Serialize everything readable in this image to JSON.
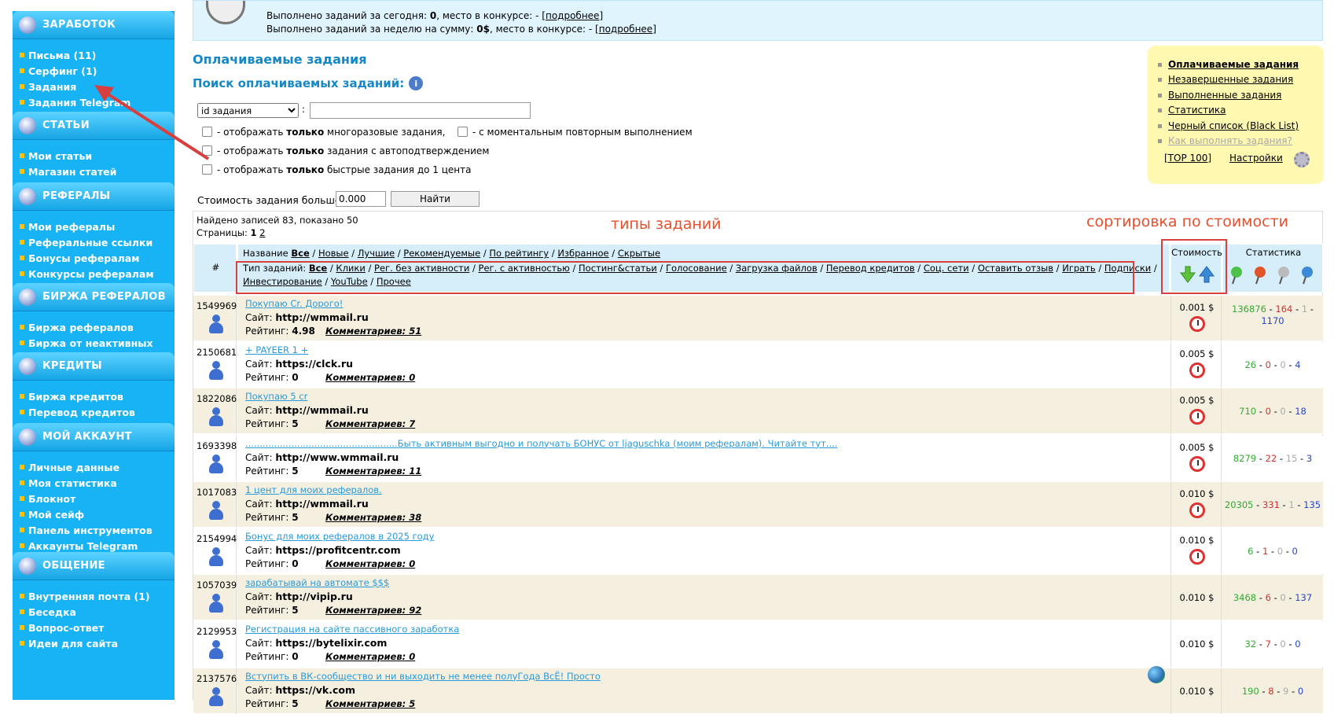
{
  "sidebar": {
    "sections": [
      {
        "title": "ЗАРАБОТОК",
        "icon": "money-bag-icon",
        "items": [
          "Письма (11)",
          "Серфинг (1)",
          "Задания",
          "Задания Telegram"
        ]
      },
      {
        "title": "СТАТЬИ",
        "icon": "articles-icon",
        "items": [
          "Мои статьи",
          "Магазин статей"
        ]
      },
      {
        "title": "РЕФЕРАЛЫ",
        "icon": "referrals-icon",
        "items": [
          "Мои рефералы",
          "Реферальные ссылки",
          "Бонусы рефералам",
          "Конкурсы рефералам"
        ]
      },
      {
        "title": "БИРЖА РЕФЕРАЛОВ",
        "icon": "exchange-icon",
        "items": [
          "Биржа рефералов",
          "Биржа от неактивных"
        ]
      },
      {
        "title": "КРЕДИТЫ",
        "icon": "credits-icon",
        "items": [
          "Биржа кредитов",
          "Перевод кредитов"
        ]
      },
      {
        "title": "МОЙ АККАУНТ",
        "icon": "account-icon",
        "items": [
          "Личные данные",
          "Моя статистика",
          "Блокнот",
          "Мой сейф",
          "Панель инструментов",
          "Аккаунты Telegram"
        ]
      },
      {
        "title": "ОБЩЕНИЕ",
        "icon": "chat-icon",
        "items": [
          "Внутренняя почта (1)",
          "Беседка",
          "Вопрос-ответ",
          "Идеи для сайта"
        ]
      }
    ]
  },
  "topbox": {
    "line1_prefix": "Выполнено заданий за сегодня: ",
    "line1_value": "0",
    "line1_mid": ", место в конкурсе: - [",
    "line1_link": "подробнее",
    "line1_end": "]",
    "line2_prefix": "Выполнено заданий за неделю на сумму: ",
    "line2_value": "0$",
    "line2_mid": ", место в конкурсе: - [",
    "line2_link": "подробнее",
    "line2_end": "]"
  },
  "page_title": "Оплачиваемые задания",
  "search_title": "Поиск оплачиваемых заданий:",
  "search": {
    "select_value": "id задания",
    "filters": [
      {
        "pre": " - отображать ",
        "bold": "только",
        "post": " многоразовые задания,"
      },
      {
        "pre": " - с моментальным повторным выполнением",
        "bold": "",
        "post": ""
      },
      {
        "pre": " - отображать ",
        "bold": "только",
        "post": " задания с автоподтверждением"
      },
      {
        "pre": " - отображать ",
        "bold": "только",
        "post": " быстрые задания до 1 цента"
      }
    ],
    "cost_label": "Стоимость задания больше",
    "cost_value": "0.000",
    "find_button": "Найти"
  },
  "right_menu": {
    "items": [
      "Оплачиваемые задания",
      "Незавершенные задания",
      "Выполненные задания",
      "Статистика",
      "Черный список (Black List)",
      "Как выполнять задания?"
    ],
    "top100": "[TOP 100]",
    "settings": "Настройки"
  },
  "results": {
    "found": "Найдено записей 83, показано 50",
    "pages_label": "Страницы: ",
    "page1": "1",
    "page2": "2"
  },
  "annotations": {
    "types": "типы заданий",
    "sort": "сортировка по стоимости"
  },
  "table_header": {
    "num": "#",
    "name_label": "Название ",
    "name_links": [
      "Все",
      "Новые",
      "Лучшие",
      "Рекомендуемые",
      "По рейтингу",
      "Избранное",
      "Скрытые"
    ],
    "type_label": "Тип заданий: ",
    "type_links": [
      "Все",
      "Клики",
      "Рег. без активности",
      "Рег. с активностью",
      "Постинг&статьи",
      "Голосование",
      "Загрузка файлов",
      "Перевод кредитов",
      "Соц. сети",
      "Оставить отзыв",
      "Играть",
      "Подписки",
      "Инвестирование",
      "YouTube",
      "Прочее"
    ],
    "cost": "Стоимость",
    "stats": "Статистика"
  },
  "rows": [
    {
      "id": "1549969",
      "title": "Покупаю Cr. Дорого!",
      "site_label": "Сайт: ",
      "site": "http://wmmail.ru",
      "rating_label": "Рейтинг: ",
      "rating": "4.98",
      "comments": "Комментариев: 51",
      "price": "0.001 $",
      "clock": true,
      "s1": "136876",
      "s2": "164",
      "s3": "1",
      "s4": "1170"
    },
    {
      "id": "2150681",
      "title": "+ PAYEER 1 +",
      "site_label": "Сайт: ",
      "site": "https://clck.ru",
      "rating_label": "Рейтинг: ",
      "rating": "0",
      "comments": "Комментариев: 0",
      "price": "0.005 $",
      "clock": true,
      "s1": "26",
      "s2": "0",
      "s3": "0",
      "s4": "4"
    },
    {
      "id": "1822086",
      "title": "Покупаю 5 cr",
      "site_label": "Сайт: ",
      "site": "http://wmmail.ru",
      "rating_label": "Рейтинг: ",
      "rating": "5",
      "comments": "Комментариев: 7",
      "price": "0.005 $",
      "clock": true,
      "s1": "710",
      "s2": "0",
      "s3": "0",
      "s4": "18"
    },
    {
      "id": "1693398",
      "title": ".....................................................Быть активным выгодно и получать БОНУС от ljaguschka (моим рефералам). Читайте тут....",
      "site_label": "Сайт: ",
      "site": "http://www.wmmail.ru",
      "rating_label": "Рейтинг: ",
      "rating": "5",
      "comments": "Комментариев: 11",
      "price": "0.005 $",
      "clock": true,
      "s1": "8279",
      "s2": "22",
      "s3": "15",
      "s4": "3"
    },
    {
      "id": "1017083",
      "title": "1 цент для моих рефералов.",
      "site_label": "Сайт: ",
      "site": "http://wmmail.ru",
      "rating_label": "Рейтинг: ",
      "rating": "5",
      "comments": "Комментариев: 38",
      "price": "0.010 $",
      "clock": true,
      "s1": "20305",
      "s2": "331",
      "s3": "1",
      "s4": "135"
    },
    {
      "id": "2154994",
      "title": "Бонус для моих рефералов в 2025 году",
      "site_label": "Сайт: ",
      "site": "https://profitcentr.com",
      "rating_label": "Рейтинг: ",
      "rating": "0",
      "comments": "Комментариев: 0",
      "price": "0.010 $",
      "clock": true,
      "s1": "6",
      "s2": "1",
      "s3": "0",
      "s4": "0"
    },
    {
      "id": "1057039",
      "title": "зарабатывай на автомате $$$",
      "site_label": "Сайт: ",
      "site": "http://vipip.ru",
      "rating_label": "Рейтинг: ",
      "rating": "5",
      "comments": "Комментариев: 92",
      "price": "0.010 $",
      "clock": false,
      "s1": "3468",
      "s2": "6",
      "s3": "0",
      "s4": "137"
    },
    {
      "id": "2129953",
      "title": "Регистрация на сайте пассивного заработка",
      "site_label": "Сайт: ",
      "site": "https://bytelixir.com",
      "rating_label": "Рейтинг: ",
      "rating": "0",
      "comments": "Комментариев: 0",
      "price": "0.010 $",
      "clock": false,
      "s1": "32",
      "s2": "7",
      "s3": "0",
      "s4": "0"
    },
    {
      "id": "2137576",
      "title": "Вступить в ВК-сообщество и ни выходить не менее полуГода ВсЁ! Просто",
      "site_label": "Сайт: ",
      "site": "https://vk.com",
      "rating_label": "Рейтинг: ",
      "rating": "5",
      "comments": "Комментариев: 5",
      "price": "0.010 $",
      "clock": false,
      "s1": "190",
      "s2": "8",
      "s3": "9",
      "s4": "0"
    }
  ]
}
